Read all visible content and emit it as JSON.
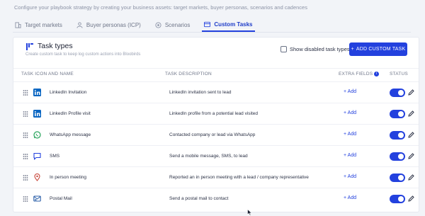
{
  "intro_text": "Configure your playbook strategy by creating your business assets: target markets, buyer personas, scenarios and cadences",
  "tabs": [
    {
      "label": "Target markets",
      "icon": "building-icon",
      "active": false
    },
    {
      "label": "Buyer personas (ICP)",
      "icon": "person-icon",
      "active": false
    },
    {
      "label": "Scenarios",
      "icon": "target-icon",
      "active": false
    },
    {
      "label": "Custom Tasks",
      "icon": "card-icon",
      "active": true
    }
  ],
  "card": {
    "title": "Task types",
    "subtitle": "Create custom task to keep log custom actions into Bloobirds",
    "show_disabled_label": "Show disabled task types",
    "show_disabled_checked": false,
    "add_button_label": "ADD CUSTOM TASK",
    "add_button_plus": "+"
  },
  "columns": {
    "icon_name": "TASK ICON AND NAME",
    "description": "TASK DESCRIPTION",
    "extra_fields": "EXTRA FIELDS",
    "extra_fields_info": "i",
    "status": "STATUS"
  },
  "tasks": [
    {
      "icon": "linkedin-icon",
      "name": "LinkedIn Invitation",
      "description": "LinkedIn invitation sent to lead",
      "add_label": "+ Add",
      "enabled": true
    },
    {
      "icon": "linkedin-icon",
      "name": "LinkedIn Profile visit",
      "description": "LinkedIn profile from a potential lead visited",
      "add_label": "+ Add",
      "enabled": true
    },
    {
      "icon": "whatsapp-icon",
      "name": "WhatsApp message",
      "description": "Contacted company or lead via WhatsApp",
      "add_label": "+ Add",
      "enabled": true
    },
    {
      "icon": "chat-icon",
      "name": "SMS",
      "description": "Send a mobile message, SMS, to lead",
      "add_label": "+ Add",
      "enabled": true
    },
    {
      "icon": "location-pin-icon",
      "name": "In person meeting",
      "description": "Reported an in person meeting with a lead / company representative",
      "add_label": "+ Add",
      "enabled": true
    },
    {
      "icon": "mail-icon",
      "name": "Postal Mail",
      "description": "Send a postal mail to contact",
      "add_label": "+ Add",
      "enabled": true
    }
  ],
  "colors": {
    "accent": "#2341de",
    "linkedin": "#0a66c2",
    "whatsapp": "#25a35a",
    "sms": "#2341de",
    "meeting": "#c8463a",
    "mail": "#2b5fa8"
  }
}
